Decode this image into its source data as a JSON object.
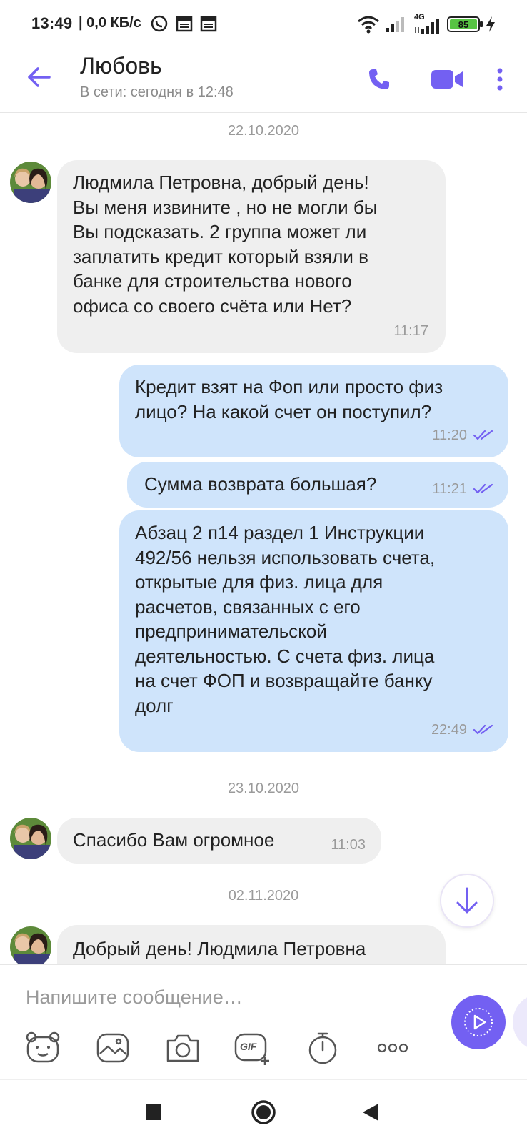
{
  "status_bar": {
    "time": "13:49",
    "network_speed": "| 0,0 КБ/с",
    "network_type": "4G",
    "battery_level": "85",
    "battery_fraction": 0.85
  },
  "header": {
    "contact_name": "Любовь",
    "contact_status": "В сети: сегодня в 12:48"
  },
  "chat": {
    "date_1": "22.10.2020",
    "msg_1": {
      "text": "Людмила Петровна, добрый день!\nВы меня извините , но не могли бы\nВы подсказать. 2 группа может ли\nзаплатить кредит который взяли в\nбанке для строительства нового\nофиса со своего счёта или Нет?",
      "time": "11:17"
    },
    "msg_2": {
      "text": "Кредит взят на Фоп или просто физ\nлицо? На какой счет он поступил?",
      "time": "11:20"
    },
    "msg_3": {
      "text": "Сумма возврата большая?",
      "time": "11:21"
    },
    "msg_4": {
      "text": "Абзац 2 п14 раздел 1 Инструкции\n492/56 нельзя использовать счета,\nоткрытые для физ. лица для\nрасчетов, связанных с его\nпредпринимательской\nдеятельностью. С счета физ. лица\nна счет  ФОП и возвращайте  банку\nдолг",
      "time": "22:49"
    },
    "date_2": "23.10.2020",
    "msg_5": {
      "text": "Спасибо Вам огромное",
      "time": "11:03"
    },
    "date_3": "02.11.2020",
    "msg_6": {
      "text": "Добрый день! Людмила Петровна"
    }
  },
  "composer": {
    "placeholder": "Напишите сообщение…",
    "gif_label": "GIF"
  },
  "colors": {
    "accent": "#7360f2",
    "incoming_bubble": "#efefef",
    "outgoing_bubble": "#cfe4fb"
  },
  "icons": {
    "back": "back-arrow-icon",
    "call": "phone-icon",
    "video": "video-camera-icon",
    "more": "more-vertical-icon",
    "sticker": "sticker-bear-icon",
    "gallery": "gallery-icon",
    "camera": "camera-icon",
    "gif": "gif-icon",
    "timer": "timer-icon",
    "more_tools": "more-horizontal-icon",
    "send": "send-icon",
    "scroll_down": "arrow-down-icon"
  }
}
